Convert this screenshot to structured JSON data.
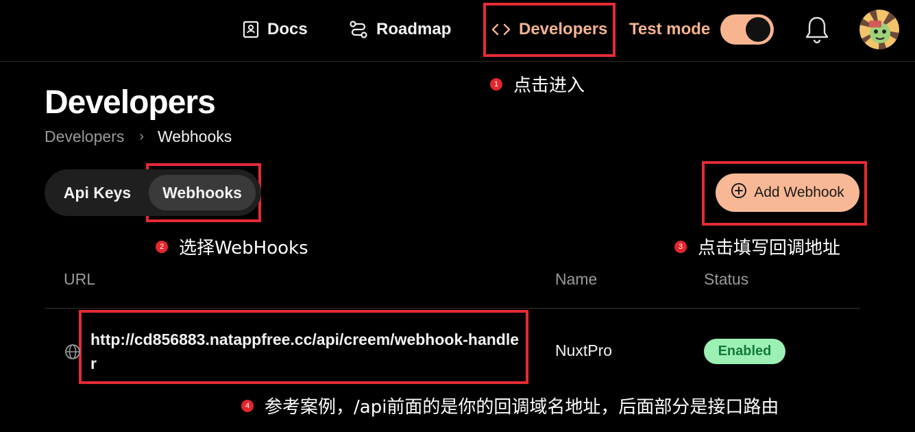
{
  "nav": {
    "docs": "Docs",
    "roadmap": "Roadmap",
    "developers": "Developers",
    "test_mode": "Test mode",
    "test_mode_on": true
  },
  "page": {
    "title": "Developers",
    "breadcrumb": {
      "parent": "Developers",
      "separator": "›",
      "current": "Webhooks"
    }
  },
  "tabs": [
    {
      "label": "Api Keys",
      "active": false
    },
    {
      "label": "Webhooks",
      "active": true
    }
  ],
  "add_webhook_label": "Add Webhook",
  "table": {
    "headers": {
      "url": "URL",
      "name": "Name",
      "status": "Status"
    },
    "rows": [
      {
        "url": "http://cd856883.natappfree.cc/api/creem/webhook-handler",
        "name": "NuxtPro",
        "status": "Enabled"
      }
    ]
  },
  "annotations": [
    {
      "num": "1",
      "text": "点击进入"
    },
    {
      "num": "2",
      "text": "选择WebHooks"
    },
    {
      "num": "3",
      "text": "点击填写回调地址"
    },
    {
      "num": "4",
      "text": "参考案例，/api前面的是你的回调域名地址，后面部分是接口路由"
    }
  ],
  "colors": {
    "accent": "#f8b48f",
    "annotation_red": "#e52b33",
    "enabled_badge_bg": "#9cf0b4",
    "enabled_badge_text": "#127a3c"
  },
  "icons": {
    "docs": "book-icon",
    "roadmap": "route-icon",
    "developers": "code-icon",
    "notifications": "bell-icon",
    "add": "plus-circle-icon",
    "url": "globe-icon"
  }
}
